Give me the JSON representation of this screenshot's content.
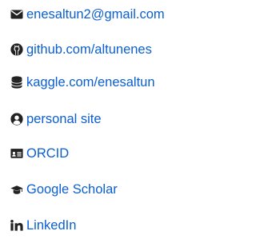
{
  "colors": {
    "link": "#0b5fd0",
    "icon": "#222222"
  },
  "links": [
    {
      "icon": "envelope-icon",
      "label": "enesaltun2@gmail.com"
    },
    {
      "icon": "github-icon",
      "label": "github.com/altunenes"
    },
    {
      "icon": "database-icon",
      "label": "kaggle.com/enesaltun"
    },
    {
      "icon": "user-circle-icon",
      "label": "personal site"
    },
    {
      "icon": "id-card-icon",
      "label": "ORCID"
    },
    {
      "icon": "graduation-cap-icon",
      "label": "Google Scholar"
    },
    {
      "icon": "linkedin-icon",
      "label": "LinkedIn"
    }
  ]
}
